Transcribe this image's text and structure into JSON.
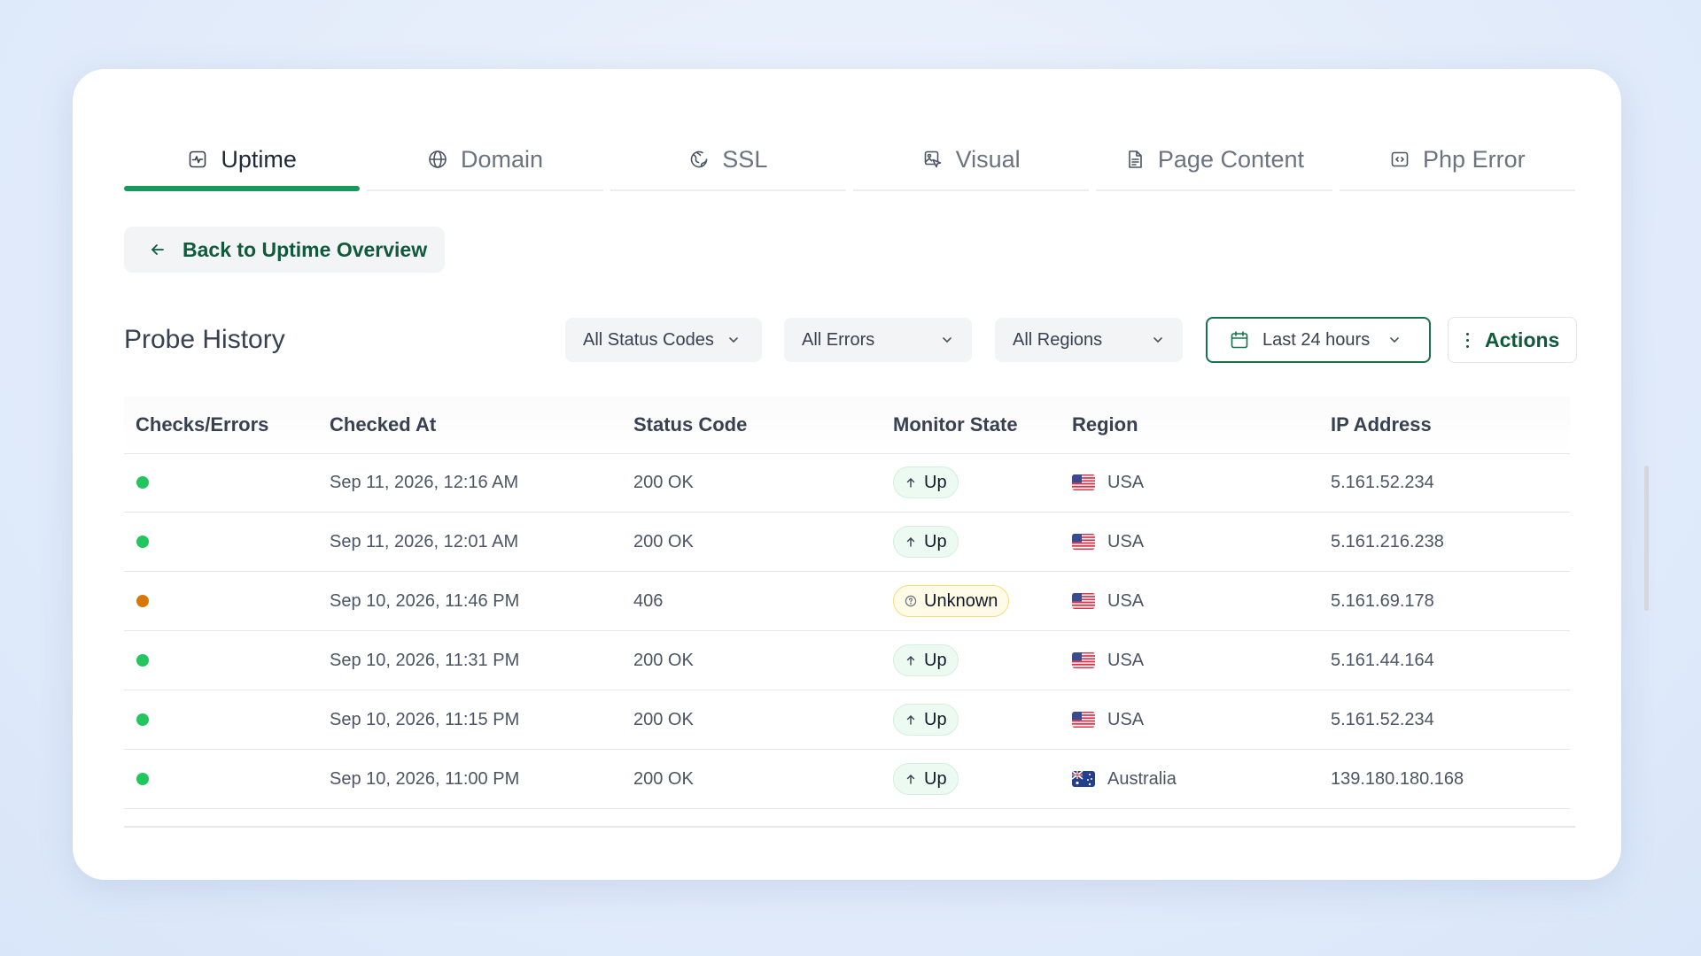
{
  "tabs": [
    {
      "label": "Uptime",
      "icon": "uptime-icon",
      "active": true
    },
    {
      "label": "Domain",
      "icon": "globe-icon",
      "active": false
    },
    {
      "label": "SSL",
      "icon": "ssl-globe-icon",
      "active": false
    },
    {
      "label": "Visual",
      "icon": "visual-icon",
      "active": false
    },
    {
      "label": "Page Content",
      "icon": "document-icon",
      "active": false
    },
    {
      "label": "Php Error",
      "icon": "code-icon",
      "active": false
    }
  ],
  "back_button": {
    "label": "Back to Uptime Overview",
    "icon": "arrow-left-icon"
  },
  "probe_history": {
    "title": "Probe History",
    "filters": {
      "status_codes": "All Status Codes",
      "errors": "All Errors",
      "regions": "All Regions"
    },
    "date_range": "Last 24 hours",
    "actions_label": "Actions"
  },
  "table": {
    "columns": [
      "Checks/Errors",
      "Checked At",
      "Status Code",
      "Monitor State",
      "Region",
      "IP Address"
    ],
    "rows": [
      {
        "status": "success",
        "checked_at": "Sep 11, 2026, 12:16 AM",
        "code": "200 OK",
        "state": "Up",
        "region": "USA",
        "flag": "usa",
        "ip": "5.161.52.234"
      },
      {
        "status": "success",
        "checked_at": "Sep 11, 2026, 12:01 AM",
        "code": "200 OK",
        "state": "Up",
        "region": "USA",
        "flag": "usa",
        "ip": "5.161.216.238"
      },
      {
        "status": "warning",
        "checked_at": "Sep 10, 2026, 11:46 PM",
        "code": "406",
        "state": "Unknown",
        "region": "USA",
        "flag": "usa",
        "ip": "5.161.69.178"
      },
      {
        "status": "success",
        "checked_at": "Sep 10, 2026, 11:31 PM",
        "code": "200 OK",
        "state": "Up",
        "region": "USA",
        "flag": "usa",
        "ip": "5.161.44.164"
      },
      {
        "status": "success",
        "checked_at": "Sep 10, 2026, 11:15 PM",
        "code": "200 OK",
        "state": "Up",
        "region": "USA",
        "flag": "usa",
        "ip": "5.161.52.234"
      },
      {
        "status": "success",
        "checked_at": "Sep 10, 2026, 11:00 PM",
        "code": "200 OK",
        "state": "Up",
        "region": "Australia",
        "flag": "australia",
        "ip": "139.180.180.168"
      }
    ]
  },
  "colors": {
    "accent": "#17995a",
    "success": "#22c55e",
    "warning": "#d97706"
  }
}
